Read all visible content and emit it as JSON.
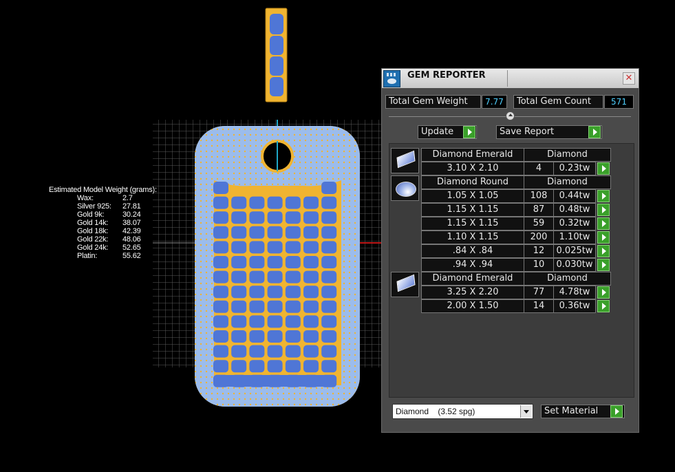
{
  "estimated_weight": {
    "title": "Estimated Model Weight (grams):",
    "rows": [
      {
        "label": "Wax:",
        "value": "2.7"
      },
      {
        "label": "Silver 925:",
        "value": "27.81"
      },
      {
        "label": "Gold 9k:",
        "value": "30.24"
      },
      {
        "label": "Gold 14k:",
        "value": "38.07"
      },
      {
        "label": "Gold 18k:",
        "value": "42.39"
      },
      {
        "label": "Gold 22k:",
        "value": "48.06"
      },
      {
        "label": "Gold 24k:",
        "value": "52.65"
      },
      {
        "label": "Platin:",
        "value": "55.62"
      }
    ]
  },
  "gem_reporter": {
    "title": "GEM REPORTER",
    "close_icon": "close-icon",
    "total_weight_label": "Total Gem Weight",
    "total_weight_value": "7.77",
    "total_count_label": "Total Gem Count",
    "total_count_value": "571",
    "update_label": "Update",
    "save_report_label": "Save Report",
    "groups": [
      {
        "icon": "emerald-gem-icon",
        "name": "Diamond Emerald",
        "material": "Diamond",
        "rows": [
          {
            "size": "3.10 X 2.10",
            "count": "4",
            "weight": "0.23tw"
          }
        ]
      },
      {
        "icon": "round-gem-icon",
        "name": "Diamond Round",
        "material": "Diamond",
        "rows": [
          {
            "size": "1.05 X 1.05",
            "count": "108",
            "weight": "0.44tw"
          },
          {
            "size": "1.15 X 1.15",
            "count": "87",
            "weight": "0.48tw"
          },
          {
            "size": "1.15 X 1.15",
            "count": "59",
            "weight": "0.32tw"
          },
          {
            "size": "1.10 X 1.15",
            "count": "200",
            "weight": "1.10tw"
          },
          {
            "size": ".84 X .84",
            "count": "12",
            "weight": "0.025tw"
          },
          {
            "size": ".94 X .94",
            "count": "10",
            "weight": "0.030tw"
          }
        ]
      },
      {
        "icon": "emerald-gem-icon",
        "name": "Diamond Emerald",
        "material": "Diamond",
        "rows": [
          {
            "size": "3.25 X 2.20",
            "count": "77",
            "weight": "4.78tw"
          },
          {
            "size": "2.00 X 1.50",
            "count": "14",
            "weight": "0.36tw"
          }
        ]
      }
    ],
    "material_select": {
      "value": "Diamond    (3.52 spg)"
    },
    "set_material_label": "Set Material"
  },
  "colors": {
    "gold": "#f0b431",
    "gem_blue": "#4f76d6",
    "pave_blue": "#9bbcec",
    "accent_cyan": "#4fd0ff",
    "go_green": "#3aa02a"
  }
}
